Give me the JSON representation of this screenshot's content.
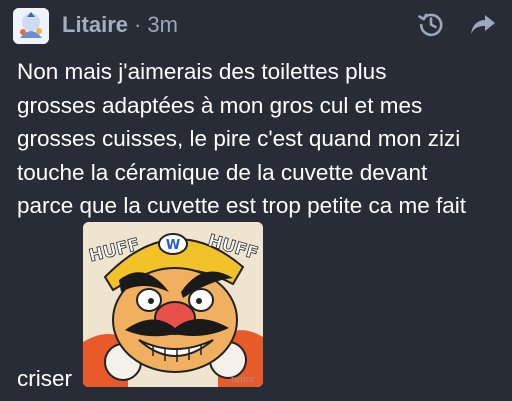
{
  "post": {
    "display_name": "Litaire",
    "separator": "·",
    "relative_time": "3m",
    "icons": {
      "avatar": "avatar-icon",
      "edit_history": "history-icon",
      "share": "share-icon"
    },
    "content_lines": [
      "Non mais j'aimerais des toilettes plus",
      "grosses adaptées à mon gros cul et mes",
      "grosses cuisses, le pire c'est quand mon zizi",
      "touche la céramique de la cuvette devant",
      "parce que la cuvette est trop petite ca me fait"
    ],
    "content_trail": "criser",
    "media": {
      "icon": "wario-gif",
      "overlay_text": [
        "HUFF",
        "HUFF"
      ],
      "watermark": "tenor"
    }
  },
  "colors": {
    "background": "#282c37",
    "text": "#ffffff",
    "muted": "#9ba7bb"
  }
}
